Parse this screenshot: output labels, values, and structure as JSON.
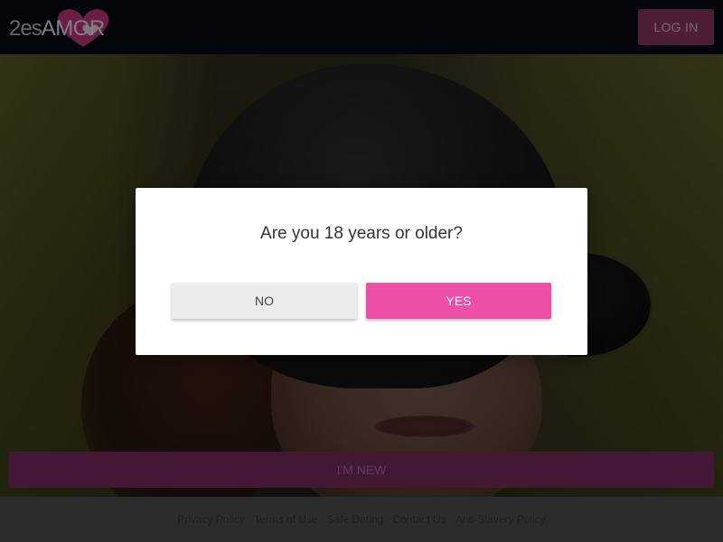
{
  "brand": {
    "logo_prefix": "2es",
    "logo_name": "AMOR",
    "accent_color": "#ed4fa8"
  },
  "header": {
    "login_label": "LOG IN"
  },
  "modal": {
    "question": "Are you 18 years or older?",
    "no_label": "NO",
    "yes_label": "YES"
  },
  "hero": {
    "new_label": "I'M NEW"
  },
  "footer": {
    "links": [
      "Privacy Policy",
      "Terms of Use",
      "Safe Dating",
      "Contact Us",
      "Anti-Slavery Policy"
    ]
  }
}
